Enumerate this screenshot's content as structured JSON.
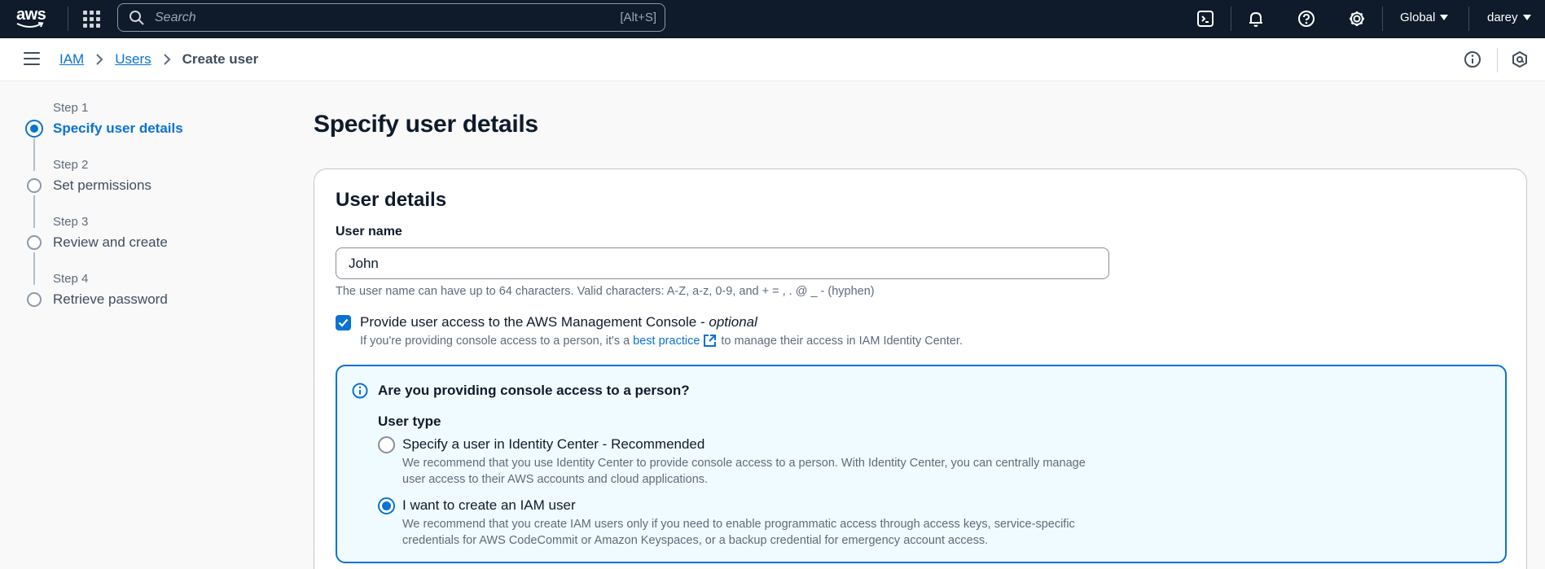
{
  "topnav": {
    "logo_text": "aws",
    "search_placeholder": "Search",
    "search_shortcut": "[Alt+S]",
    "region": "Global",
    "user": "darey"
  },
  "breadcrumb": {
    "items": [
      "IAM",
      "Users"
    ],
    "current": "Create user"
  },
  "steps": [
    {
      "num": "Step 1",
      "title": "Specify user details",
      "active": true
    },
    {
      "num": "Step 2",
      "title": "Set permissions",
      "active": false
    },
    {
      "num": "Step 3",
      "title": "Review and create",
      "active": false
    },
    {
      "num": "Step 4",
      "title": "Retrieve password",
      "active": false
    }
  ],
  "main": {
    "title": "Specify user details",
    "card_title": "User details",
    "username_label": "User name",
    "username_value": "John",
    "username_hint": "The user name can have up to 64 characters. Valid characters: A-Z, a-z, 0-9, and + = , . @ _ - (hyphen)",
    "console_access_label": "Provide user access to the AWS Management Console - ",
    "console_access_optional": "optional",
    "console_access_checked": true,
    "console_desc_before": "If you're providing console access to a person, it's a",
    "console_desc_link": "best practice",
    "console_desc_after": "to manage their access in IAM Identity Center.",
    "info_title": "Are you providing console access to a person?",
    "user_type_label": "User type",
    "options": [
      {
        "label": "Specify a user in Identity Center - Recommended",
        "desc": "We recommend that you use Identity Center to provide console access to a person. With Identity Center, you can centrally manage user access to their AWS accounts and cloud applications.",
        "checked": false
      },
      {
        "label": "I want to create an IAM user",
        "desc": "We recommend that you create IAM users only if you need to enable programmatic access through access keys, service-specific credentials for AWS CodeCommit or Amazon Keyspaces, or a backup credential for emergency account access.",
        "checked": true
      }
    ]
  },
  "colors": {
    "accent": "#0972d3",
    "nav_bg": "#0f1b2a",
    "info_bg": "#f0fbff"
  }
}
